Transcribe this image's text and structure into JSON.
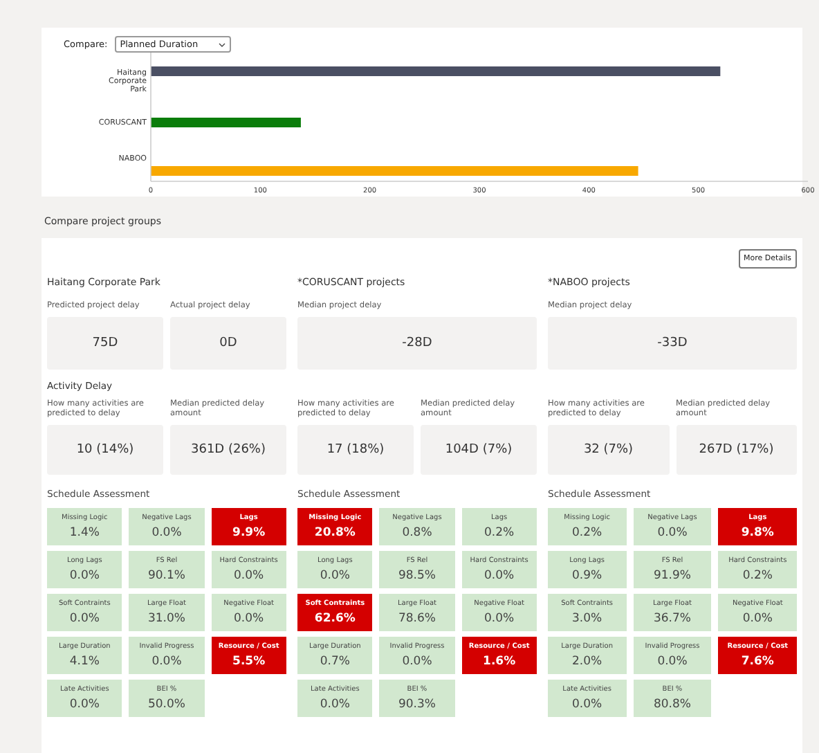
{
  "compare": {
    "label": "Compare:",
    "value": "Planned Duration"
  },
  "chart": {
    "chart_data": {
      "type": "bar",
      "orientation": "horizontal",
      "stacked": true,
      "xlim": [
        0,
        600
      ],
      "xticks": [
        0,
        100,
        200,
        300,
        400,
        500,
        600
      ],
      "series": [
        {
          "name": "Haitang Corporate Park",
          "color": "#4a4f63",
          "values": [
            520,
            null,
            null
          ]
        },
        {
          "name": "CORUSCANT",
          "color": "#0b7d0b",
          "values": [
            null,
            137,
            null
          ]
        },
        {
          "name": "NABOO",
          "color": "#f8a800",
          "values": [
            null,
            null,
            445
          ]
        }
      ]
    }
  },
  "section_title": "Compare project groups",
  "more_details": "More Details",
  "activity_heading": "Activity Delay",
  "groups": [
    {
      "title": "Haitang Corporate Park",
      "delays": [
        {
          "label": "Predicted project delay",
          "value": "75D"
        },
        {
          "label": "Actual project delay",
          "value": "0D"
        }
      ],
      "activity": [
        {
          "label": "How many activities are predicted to delay",
          "value": "10 (14%)"
        },
        {
          "label": "Median predicted delay amount",
          "value": "361D (26%)"
        }
      ],
      "assessment_title": "Schedule Assessment",
      "tiles": [
        {
          "label": "Missing Logic",
          "value": "1.4%",
          "kind": "ok"
        },
        {
          "label": "Negative Lags",
          "value": "0.0%",
          "kind": "ok"
        },
        {
          "label": "Lags",
          "value": "9.9%",
          "kind": "alert"
        },
        {
          "label": "Long Lags",
          "value": "0.0%",
          "kind": "ok"
        },
        {
          "label": "FS Rel",
          "value": "90.1%",
          "kind": "ok"
        },
        {
          "label": "Hard Constraints",
          "value": "0.0%",
          "kind": "ok"
        },
        {
          "label": "Soft Contraints",
          "value": "0.0%",
          "kind": "ok"
        },
        {
          "label": "Large Float",
          "value": "31.0%",
          "kind": "ok"
        },
        {
          "label": "Negative Float",
          "value": "0.0%",
          "kind": "ok"
        },
        {
          "label": "Large Duration",
          "value": "4.1%",
          "kind": "ok"
        },
        {
          "label": "Invalid Progress",
          "value": "0.0%",
          "kind": "ok"
        },
        {
          "label": "Resource / Cost",
          "value": "5.5%",
          "kind": "alert"
        },
        {
          "label": "Late Activities",
          "value": "0.0%",
          "kind": "ok"
        },
        {
          "label": "BEI %",
          "value": "50.0%",
          "kind": "ok"
        }
      ]
    },
    {
      "title": "*CORUSCANT projects",
      "delays": [
        {
          "label": "Median project delay",
          "value": "-28D"
        }
      ],
      "activity": [
        {
          "label": "How many activities are predicted to delay",
          "value": "17 (18%)"
        },
        {
          "label": "Median predicted delay amount",
          "value": "104D (7%)"
        }
      ],
      "assessment_title": "Schedule Assessment",
      "tiles": [
        {
          "label": "Missing Logic",
          "value": "20.8%",
          "kind": "alert"
        },
        {
          "label": "Negative Lags",
          "value": "0.8%",
          "kind": "ok"
        },
        {
          "label": "Lags",
          "value": "0.2%",
          "kind": "ok"
        },
        {
          "label": "Long Lags",
          "value": "0.0%",
          "kind": "ok"
        },
        {
          "label": "FS Rel",
          "value": "98.5%",
          "kind": "ok"
        },
        {
          "label": "Hard Constraints",
          "value": "0.0%",
          "kind": "ok"
        },
        {
          "label": "Soft Contraints",
          "value": "62.6%",
          "kind": "alert"
        },
        {
          "label": "Large Float",
          "value": "78.6%",
          "kind": "ok"
        },
        {
          "label": "Negative Float",
          "value": "0.0%",
          "kind": "ok"
        },
        {
          "label": "Large Duration",
          "value": "0.7%",
          "kind": "ok"
        },
        {
          "label": "Invalid Progress",
          "value": "0.0%",
          "kind": "ok"
        },
        {
          "label": "Resource / Cost",
          "value": "1.6%",
          "kind": "alert"
        },
        {
          "label": "Late Activities",
          "value": "0.0%",
          "kind": "ok"
        },
        {
          "label": "BEI %",
          "value": "90.3%",
          "kind": "ok"
        }
      ]
    },
    {
      "title": "*NABOO projects",
      "delays": [
        {
          "label": "Median project delay",
          "value": "-33D"
        }
      ],
      "activity": [
        {
          "label": "How many activities are predicted to delay",
          "value": "32 (7%)"
        },
        {
          "label": "Median predicted delay amount",
          "value": "267D (17%)"
        }
      ],
      "assessment_title": "Schedule Assessment",
      "tiles": [
        {
          "label": "Missing Logic",
          "value": "0.2%",
          "kind": "ok"
        },
        {
          "label": "Negative Lags",
          "value": "0.0%",
          "kind": "ok"
        },
        {
          "label": "Lags",
          "value": "9.8%",
          "kind": "alert"
        },
        {
          "label": "Long Lags",
          "value": "0.9%",
          "kind": "ok"
        },
        {
          "label": "FS Rel",
          "value": "91.9%",
          "kind": "ok"
        },
        {
          "label": "Hard Constraints",
          "value": "0.2%",
          "kind": "ok"
        },
        {
          "label": "Soft Contraints",
          "value": "3.0%",
          "kind": "ok"
        },
        {
          "label": "Large Float",
          "value": "36.7%",
          "kind": "ok"
        },
        {
          "label": "Negative Float",
          "value": "0.0%",
          "kind": "ok"
        },
        {
          "label": "Large Duration",
          "value": "2.0%",
          "kind": "ok"
        },
        {
          "label": "Invalid Progress",
          "value": "0.0%",
          "kind": "ok"
        },
        {
          "label": "Resource / Cost",
          "value": "7.6%",
          "kind": "alert"
        },
        {
          "label": "Late Activities",
          "value": "0.0%",
          "kind": "ok"
        },
        {
          "label": "BEI %",
          "value": "80.8%",
          "kind": "ok"
        }
      ]
    }
  ]
}
